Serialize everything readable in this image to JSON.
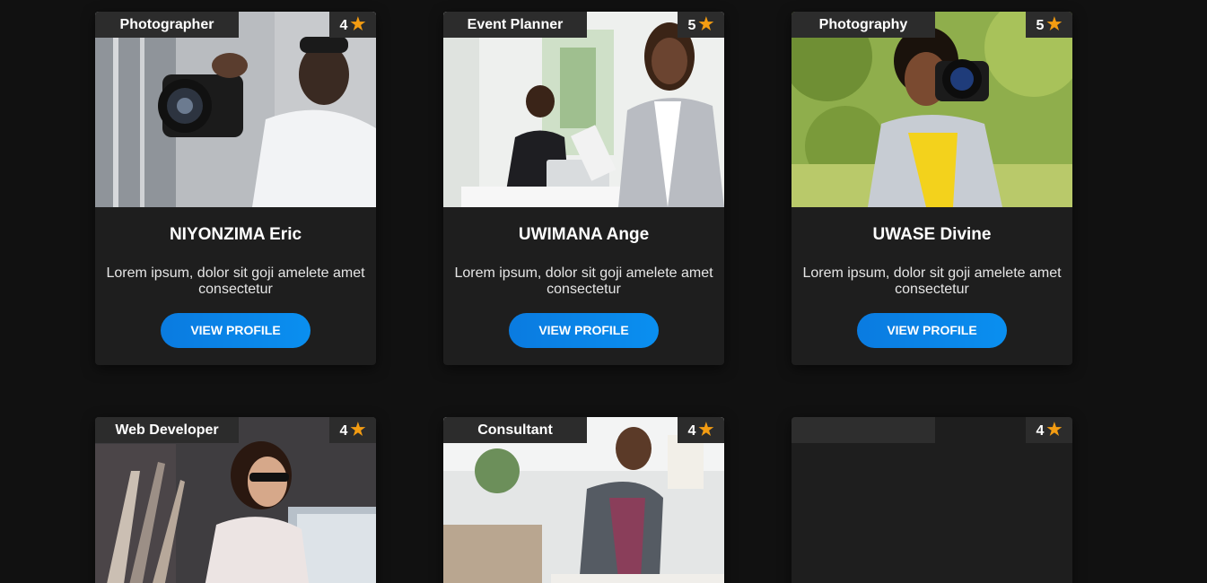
{
  "colors": {
    "background": "#111111",
    "card": "#1e1e1e",
    "tag": "#2c2c2c",
    "accent_button": "#0a84e8",
    "star": "#f39c12"
  },
  "cards": [
    {
      "category": "Photographer",
      "rating": "4",
      "name": "NIYONZIMA Eric",
      "description": "Lorem ipsum, dolor sit goji amelete amet consectetur",
      "button": "VIEW PROFILE"
    },
    {
      "category": "Event Planner",
      "rating": "5",
      "name": "UWIMANA Ange",
      "description": "Lorem ipsum, dolor sit goji amelete amet consectetur",
      "button": "VIEW PROFILE"
    },
    {
      "category": "Photography",
      "rating": "5",
      "name": "UWASE Divine",
      "description": "Lorem ipsum, dolor sit goji amelete amet consectetur",
      "button": "VIEW PROFILE"
    },
    {
      "category": "Web Developer",
      "rating": "4"
    },
    {
      "category": "Consultant",
      "rating": "4"
    },
    {
      "category": "",
      "rating": "4"
    }
  ],
  "star_icon": "star-icon"
}
